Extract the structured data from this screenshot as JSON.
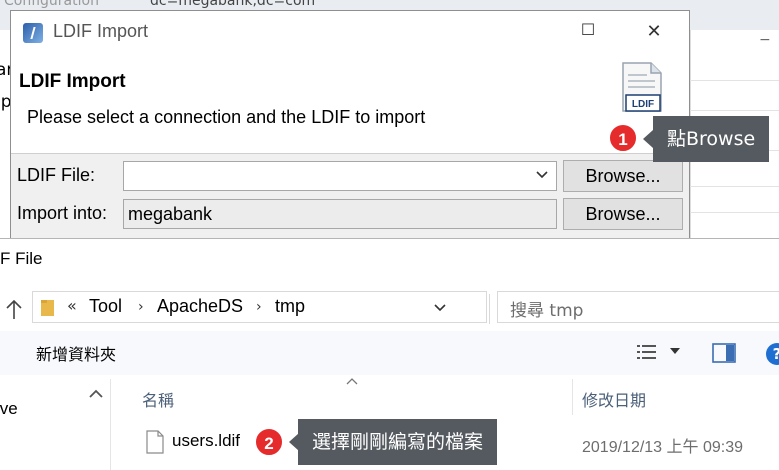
{
  "background": {
    "tabs": [
      "Configuration",
      "dc=megabank,dc=com"
    ],
    "left_fragments": [
      "ar",
      "ip"
    ]
  },
  "dialog": {
    "title": "LDIF Import",
    "banner_title": "LDIF Import",
    "banner_desc": "Please select a connection and the LDIF to import",
    "banner_icon_text": "LDIF",
    "ldif_file_label": "LDIF File:",
    "ldif_file_value": "",
    "import_into_label": "Import into:",
    "import_into_value": "megabank",
    "browse_label": "Browse...",
    "minimize": "—",
    "maximize": "☐",
    "close": "✕"
  },
  "callouts": [
    {
      "number": "1",
      "text": "點Browse"
    },
    {
      "number": "2",
      "text": "選擇剛剛編寫的檔案"
    }
  ],
  "file_dialog": {
    "title_fragment": "F File",
    "path_prefix": "«",
    "path": [
      "Tool",
      "ApacheDS",
      "tmp"
    ],
    "search_placeholder": "搜尋 tmp",
    "new_folder": "新增資料夾",
    "col_name": "名稱",
    "col_modified": "修改日期",
    "left_item": "ive",
    "files": [
      {
        "name": "users.ldif",
        "modified": "2019/12/13 上午 09:39"
      }
    ]
  },
  "colors": {
    "badge": "#e52b2b",
    "callout_bg": "#555a60",
    "header_text": "#4c607a"
  }
}
